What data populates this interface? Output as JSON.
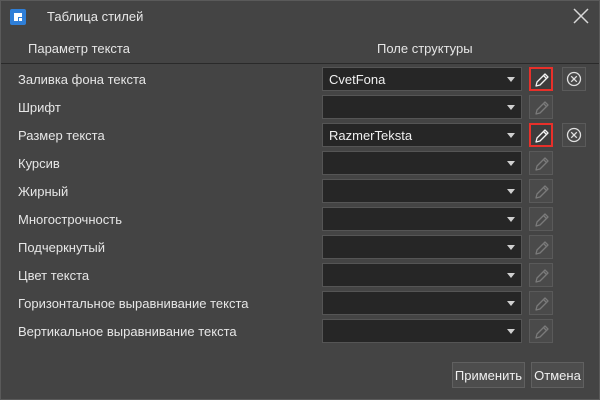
{
  "window": {
    "title": "Таблица стилей",
    "app_icon": "app-logo-icon",
    "close_icon": "close-icon"
  },
  "header": {
    "col_param": "Параметр текста",
    "col_field": "Поле структуры"
  },
  "rows": [
    {
      "label": "Заливка фона текста",
      "value": "CvetFona",
      "edit_active": true,
      "has_clear": true
    },
    {
      "label": "Шрифт",
      "value": "",
      "edit_active": false,
      "has_clear": false
    },
    {
      "label": "Размер текста",
      "value": "RazmerTeksta",
      "edit_active": true,
      "has_clear": true
    },
    {
      "label": "Курсив",
      "value": "",
      "edit_active": false,
      "has_clear": false
    },
    {
      "label": "Жирный",
      "value": "",
      "edit_active": false,
      "has_clear": false
    },
    {
      "label": "Многострочность",
      "value": "",
      "edit_active": false,
      "has_clear": false
    },
    {
      "label": "Подчеркнутый",
      "value": "",
      "edit_active": false,
      "has_clear": false
    },
    {
      "label": "Цвет текста",
      "value": "",
      "edit_active": false,
      "has_clear": false
    },
    {
      "label": "Горизонтальное выравнивание текста",
      "value": "",
      "edit_active": false,
      "has_clear": false
    },
    {
      "label": "Вертикальное выравнивание текста",
      "value": "",
      "edit_active": false,
      "has_clear": false
    }
  ],
  "footer": {
    "apply_label": "Применить",
    "cancel_label": "Отмена"
  },
  "colors": {
    "background": "#444444",
    "field_background": "#262626",
    "highlight": "#e8302a"
  }
}
